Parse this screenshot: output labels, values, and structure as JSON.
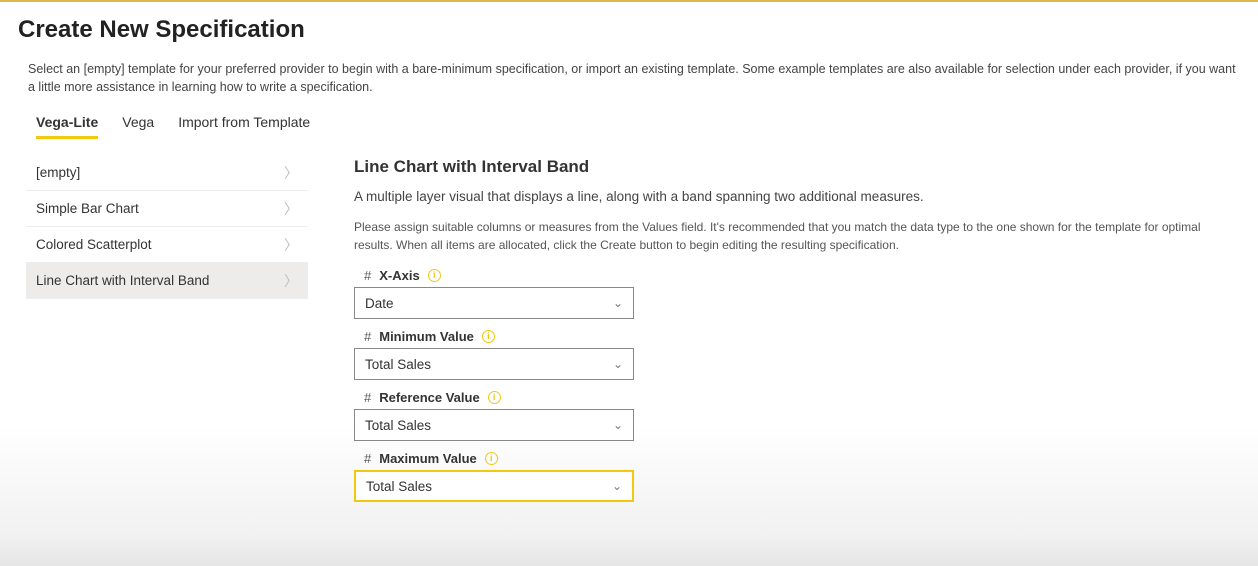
{
  "header": {
    "title": "Create New Specification",
    "description": "Select an [empty] template for your preferred provider to begin with a bare-minimum specification, or import an existing template. Some example templates are also available for selection under each provider, if you want a little more assistance in learning how to write a specification."
  },
  "tabs": [
    {
      "label": "Vega-Lite",
      "active": true
    },
    {
      "label": "Vega",
      "active": false
    },
    {
      "label": "Import from Template",
      "active": false
    }
  ],
  "sidebar": {
    "items": [
      {
        "label": "[empty]",
        "selected": false
      },
      {
        "label": "Simple Bar Chart",
        "selected": false
      },
      {
        "label": "Colored Scatterplot",
        "selected": false
      },
      {
        "label": "Line Chart with Interval Band",
        "selected": true
      }
    ]
  },
  "preview": {
    "title": "Line Chart with Interval Band",
    "subtitle": "A multiple layer visual that displays a line, along with a band spanning two additional measures.",
    "hint": "Please assign suitable columns or measures from the Values field. It's recommended that you match the data type to the one shown for the template for optimal results. When all items are allocated, click the Create button to begin editing the resulting specification.",
    "fields": [
      {
        "label": "X-Axis",
        "value": "Date",
        "active": false
      },
      {
        "label": "Minimum Value",
        "value": "Total Sales",
        "active": false
      },
      {
        "label": "Reference Value",
        "value": "Total Sales",
        "active": false
      },
      {
        "label": "Maximum Value",
        "value": "Total Sales",
        "active": true
      }
    ]
  }
}
